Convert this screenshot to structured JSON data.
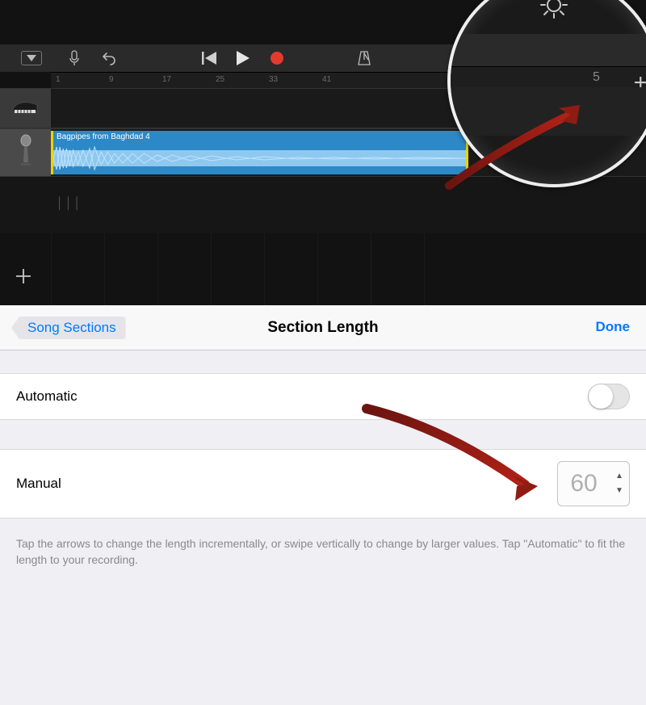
{
  "toolbar": {
    "ruler_ticks": [
      "1",
      "9",
      "17",
      "25",
      "33",
      "41"
    ],
    "region_title": "Bagpipes from Baghdad 4"
  },
  "magnifier": {
    "ruler_tick": "5"
  },
  "panel": {
    "back_label": "Song Sections",
    "title": "Section Length",
    "done_label": "Done",
    "automatic_label": "Automatic",
    "automatic_on": false,
    "manual_label": "Manual",
    "manual_value": "60",
    "footer": "Tap the arrows to change the length incrementally, or swipe vertically to change by larger values. Tap \"Automatic\" to fit the length to your recording."
  }
}
